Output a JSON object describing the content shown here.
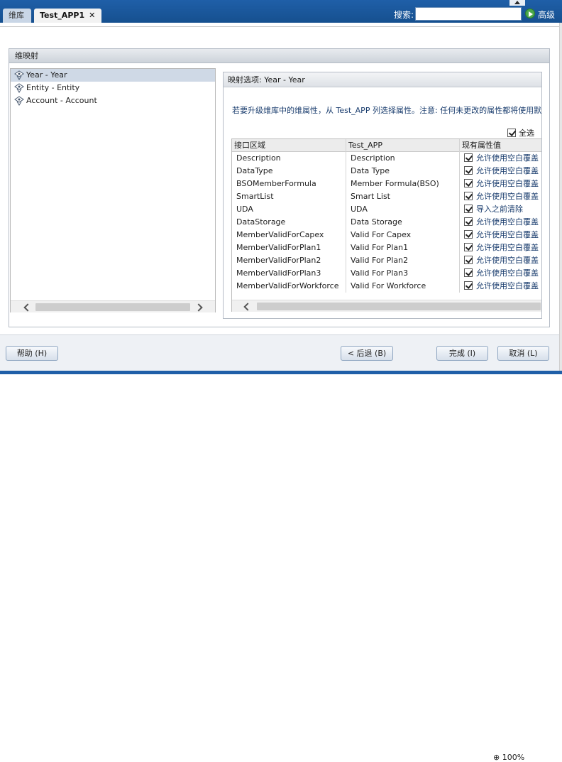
{
  "tabs": [
    {
      "label": "维库"
    },
    {
      "label": "Test_APP1",
      "close": "✕"
    }
  ],
  "search": {
    "label": "搜索:",
    "value": "",
    "advanced": "高级"
  },
  "panel": {
    "title": "维映射"
  },
  "tree": {
    "items": [
      {
        "label": "Year - Year",
        "selected": true
      },
      {
        "label": "Entity - Entity",
        "selected": false
      },
      {
        "label": "Account - Account",
        "selected": false
      }
    ]
  },
  "options": {
    "title": "映射选项: Year - Year",
    "description": "若要升级维库中的维属性，从 Test_APP 列选择属性。注意: 任何未更改的属性都将使用默认原",
    "select_all": "全选",
    "columns": [
      "接口区域",
      "Test_APP",
      "现有属性值"
    ],
    "rows": [
      {
        "area": "Description",
        "app": "Description",
        "value": "允许使用空白覆盖",
        "checked": true
      },
      {
        "area": "DataType",
        "app": "Data Type",
        "value": "允许使用空白覆盖",
        "checked": true
      },
      {
        "area": "BSOMemberFormula",
        "app": "Member Formula(BSO)",
        "value": "允许使用空白覆盖",
        "checked": true
      },
      {
        "area": "SmartList",
        "app": "Smart List",
        "value": "允许使用空白覆盖",
        "checked": true
      },
      {
        "area": "UDA",
        "app": "UDA",
        "value": "导入之前清除",
        "checked": true
      },
      {
        "area": "DataStorage",
        "app": "Data Storage",
        "value": "允许使用空白覆盖",
        "checked": true
      },
      {
        "area": "MemberValidForCapex",
        "app": "Valid For Capex",
        "value": "允许使用空白覆盖",
        "checked": true
      },
      {
        "area": "MemberValidForPlan1",
        "app": "Valid For Plan1",
        "value": "允许使用空白覆盖",
        "checked": true
      },
      {
        "area": "MemberValidForPlan2",
        "app": "Valid For Plan2",
        "value": "允许使用空白覆盖",
        "checked": true
      },
      {
        "area": "MemberValidForPlan3",
        "app": "Valid For Plan3",
        "value": "允许使用空白覆盖",
        "checked": true
      },
      {
        "area": "MemberValidForWorkforce",
        "app": "Valid For Workforce",
        "value": "允许使用空白覆盖",
        "checked": true
      }
    ]
  },
  "buttons": {
    "help": "帮助 (H)",
    "back": "< 后退 (B)",
    "finish": "完成 (I)",
    "cancel": "取消 (L)"
  },
  "status": {
    "zoom": "100%"
  },
  "colors": {
    "topbar": "#1f5fa8",
    "panel_header": "#cdd3da",
    "selected_row": "#cfd9e6"
  },
  "icons": [
    "close-icon",
    "go-icon",
    "dimension-icon",
    "chevron-left-icon",
    "chevron-right-icon",
    "checkbox-icon",
    "zoom-icon"
  ]
}
